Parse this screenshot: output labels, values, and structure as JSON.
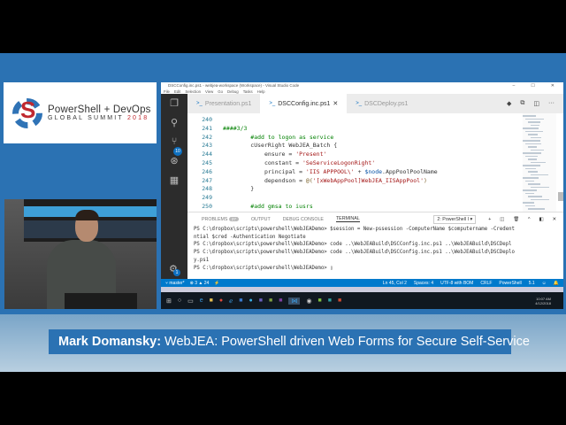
{
  "logo": {
    "line1": "PowerShell + DevOps",
    "line2": "GLOBAL SUMMIT",
    "year": "2018"
  },
  "window": {
    "title": "DSCConfig.inc.ps1 - webjea-workspace (Workspace) - Visual Studio Code",
    "menu": [
      "File",
      "Edit",
      "Selection",
      "View",
      "Go",
      "Debug",
      "Tasks",
      "Help"
    ]
  },
  "activity": {
    "scm_badge": "10",
    "settings_badge": "1"
  },
  "tabs": [
    {
      "label": "Presentation.ps1"
    },
    {
      "label": "DSCConfig.inc.ps1",
      "active": true
    },
    {
      "label": "DSCDeploy.ps1"
    }
  ],
  "code": [
    {
      "n": "240",
      "parts": []
    },
    {
      "n": "241",
      "parts": [
        {
          "c": "cm",
          "t": "####3/3"
        }
      ]
    },
    {
      "n": "242",
      "parts": [
        {
          "c": "cm",
          "t": "        #add to logon as service"
        }
      ]
    },
    {
      "n": "243",
      "parts": [
        {
          "c": "tx",
          "t": "        cUserRight WebJEA_Batch {"
        }
      ]
    },
    {
      "n": "244",
      "parts": [
        {
          "c": "tx",
          "t": "            ensure = "
        },
        {
          "c": "st",
          "t": "'Present'"
        }
      ]
    },
    {
      "n": "245",
      "parts": [
        {
          "c": "tx",
          "t": "            constant = "
        },
        {
          "c": "st",
          "t": "'SeServiceLogonRight'"
        }
      ]
    },
    {
      "n": "246",
      "parts": [
        {
          "c": "tx",
          "t": "            principal = "
        },
        {
          "c": "st",
          "t": "'IIS APPPOOL\\'"
        },
        {
          "c": "tx",
          "t": " + "
        },
        {
          "c": "vr",
          "t": "$node"
        },
        {
          "c": "tx",
          "t": ".AppPoolPoolName"
        }
      ]
    },
    {
      "n": "247",
      "parts": [
        {
          "c": "tx",
          "t": "            dependson = "
        },
        {
          "c": "ce",
          "t": "@("
        },
        {
          "c": "st",
          "t": "'[xWebAppPool]WebJEA_IISAppPool'"
        },
        {
          "c": "ce",
          "t": ")"
        }
      ]
    },
    {
      "n": "248",
      "parts": [
        {
          "c": "tx",
          "t": "        }"
        }
      ]
    },
    {
      "n": "249",
      "parts": []
    },
    {
      "n": "250",
      "parts": [
        {
          "c": "cm",
          "t": "        #add gmsa to iusrs"
        }
      ]
    }
  ],
  "panel": {
    "tabs": [
      "PROBLEMS",
      "OUTPUT",
      "DEBUG CONSOLE",
      "TERMINAL"
    ],
    "problems_count": "27",
    "terminal_select": "2: PowerShell I ▾"
  },
  "terminal": [
    "PS C:\\dropbox\\scripts\\powershell\\WebJEADemo> $session = New-pssession -ComputerName $computername -Credent",
    "ntial $cred -Authentication Negotiate",
    "PS C:\\dropbox\\scripts\\powershell\\WebJEADemo> code ..\\WebJEABuild\\DSCConfig.inc.ps1 ..\\WebJEABuild\\DSCDepl",
    "PS C:\\dropbox\\scripts\\powershell\\WebJEADemo> code ..\\WebJEABuild\\DSCConfig.inc.ps1 ..\\WebJEABuild\\DSCDeplo",
    "y.ps1",
    "PS C:\\dropbox\\scripts\\powershell\\WebJEADemo> ▯"
  ],
  "status": {
    "branch": "master*",
    "errors": "⊗ 3",
    "warnings": "▲ 24",
    "position": "Ln 45, Col 2",
    "spaces": "Spaces: 4",
    "encoding": "UTF-8 with BOM",
    "eol": "CRLF",
    "language": "PowerShell",
    "version": "5.1"
  },
  "taskbar": {
    "time": "10:07 AM",
    "date": "4/12/2018"
  },
  "caption": {
    "speaker": "Mark Domansky:",
    "title": "WebJEA: PowerShell driven Web Forms for Secure Self-Service"
  }
}
